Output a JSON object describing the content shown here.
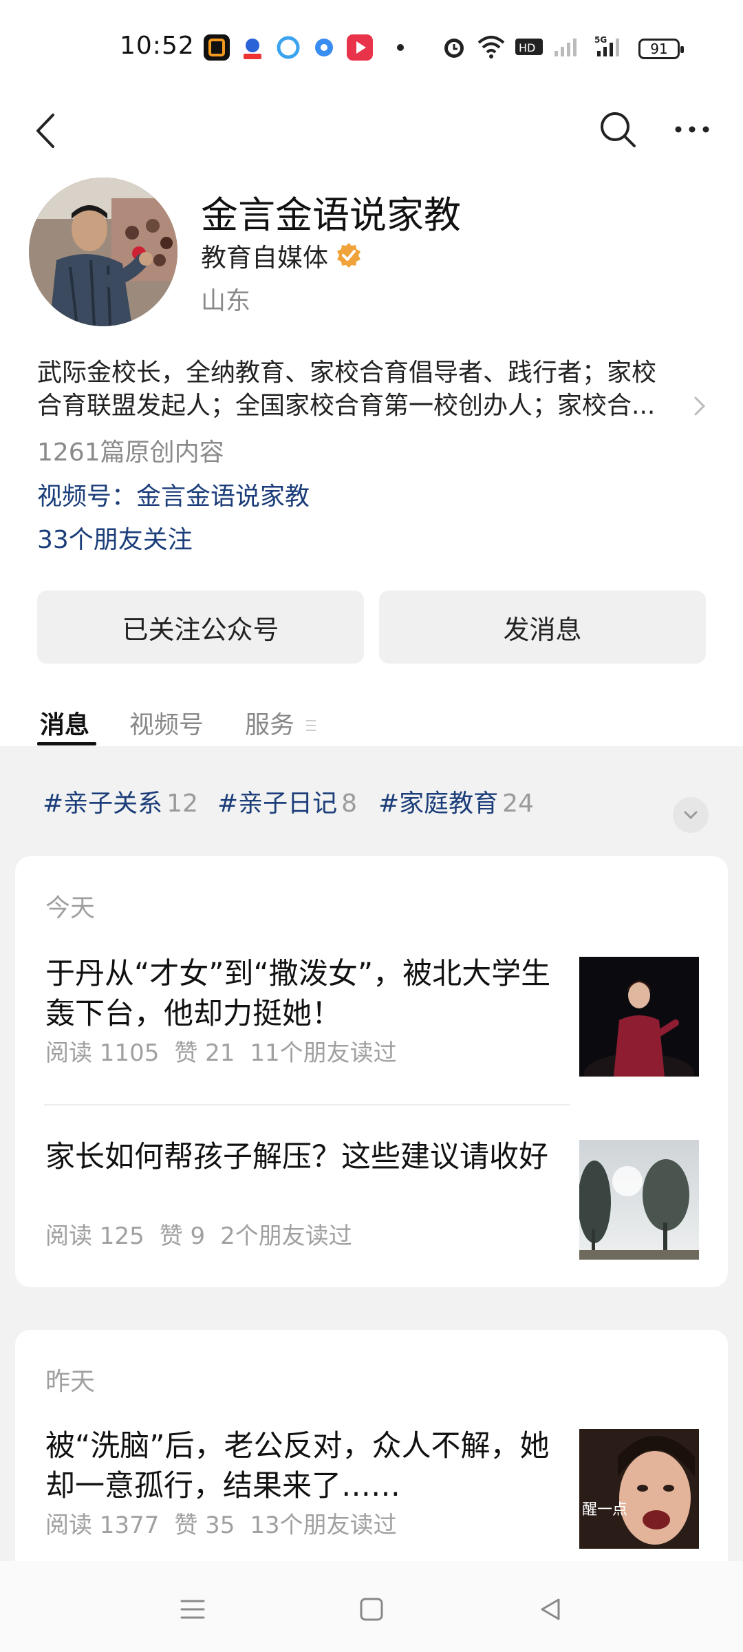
{
  "status_bar": {
    "time": "10:52",
    "battery": "91",
    "icons": [
      "app-notification-icon",
      "baidu-icon",
      "qq-browser-icon",
      "app-dot-icon",
      "video-app-icon",
      "dot-icon",
      "alarm-icon",
      "wifi-icon",
      "hd-icon",
      "signal-icon",
      "5g-signal-icon",
      "battery-icon"
    ]
  },
  "nav": {
    "back_icon": "chevron-left-icon",
    "search_icon": "search-icon",
    "more_icon": "more-horizontal-icon"
  },
  "profile": {
    "name": "金言金语说家教",
    "subtitle": "教育自媒体",
    "location": "山东",
    "bio_line1": "武际金校长，全纳教育、家校合育倡导者、践行者；家校",
    "bio_line2": "合育联盟发起人；全国家校合育第一校创办人；家校合...",
    "articles_count": "1261篇原创内容",
    "video_account": "视频号：金言金语说家教",
    "friends_following": "33个朋友关注"
  },
  "buttons": {
    "follow": "已关注公众号",
    "message": "发消息"
  },
  "tabs": [
    {
      "label": "消息",
      "active": true
    },
    {
      "label": "视频号",
      "active": false
    },
    {
      "label": "服务",
      "active": false
    }
  ],
  "tags": [
    {
      "label": "#亲子关系",
      "count": "12"
    },
    {
      "label": "#亲子日记",
      "count": "8"
    },
    {
      "label": "#家庭教育",
      "count": "24"
    }
  ],
  "sections": [
    {
      "label": "今天",
      "articles": [
        {
          "title": "于丹从“才女”到“撒泼女”，被北大学生轰下台，他却力挺她！",
          "reads": "阅读 1105",
          "likes": "赞 21",
          "friends": "11个朋友读过"
        },
        {
          "title": "家长如何帮孩子解压？这些建议请收好",
          "reads": "阅读 125",
          "likes": "赞 9",
          "friends": "2个朋友读过"
        }
      ]
    },
    {
      "label": "昨天",
      "articles": [
        {
          "title": "被“洗脑”后，老公反对，众人不解，她却一意孤行，结果来了……",
          "reads": "阅读 1377",
          "likes": "赞 35",
          "friends": "13个朋友读过"
        }
      ]
    }
  ],
  "thumb3_caption": "醒一点",
  "colors": {
    "link": "#1b3d79",
    "verified": "#f0a33a",
    "muted": "#a0a0a0"
  }
}
